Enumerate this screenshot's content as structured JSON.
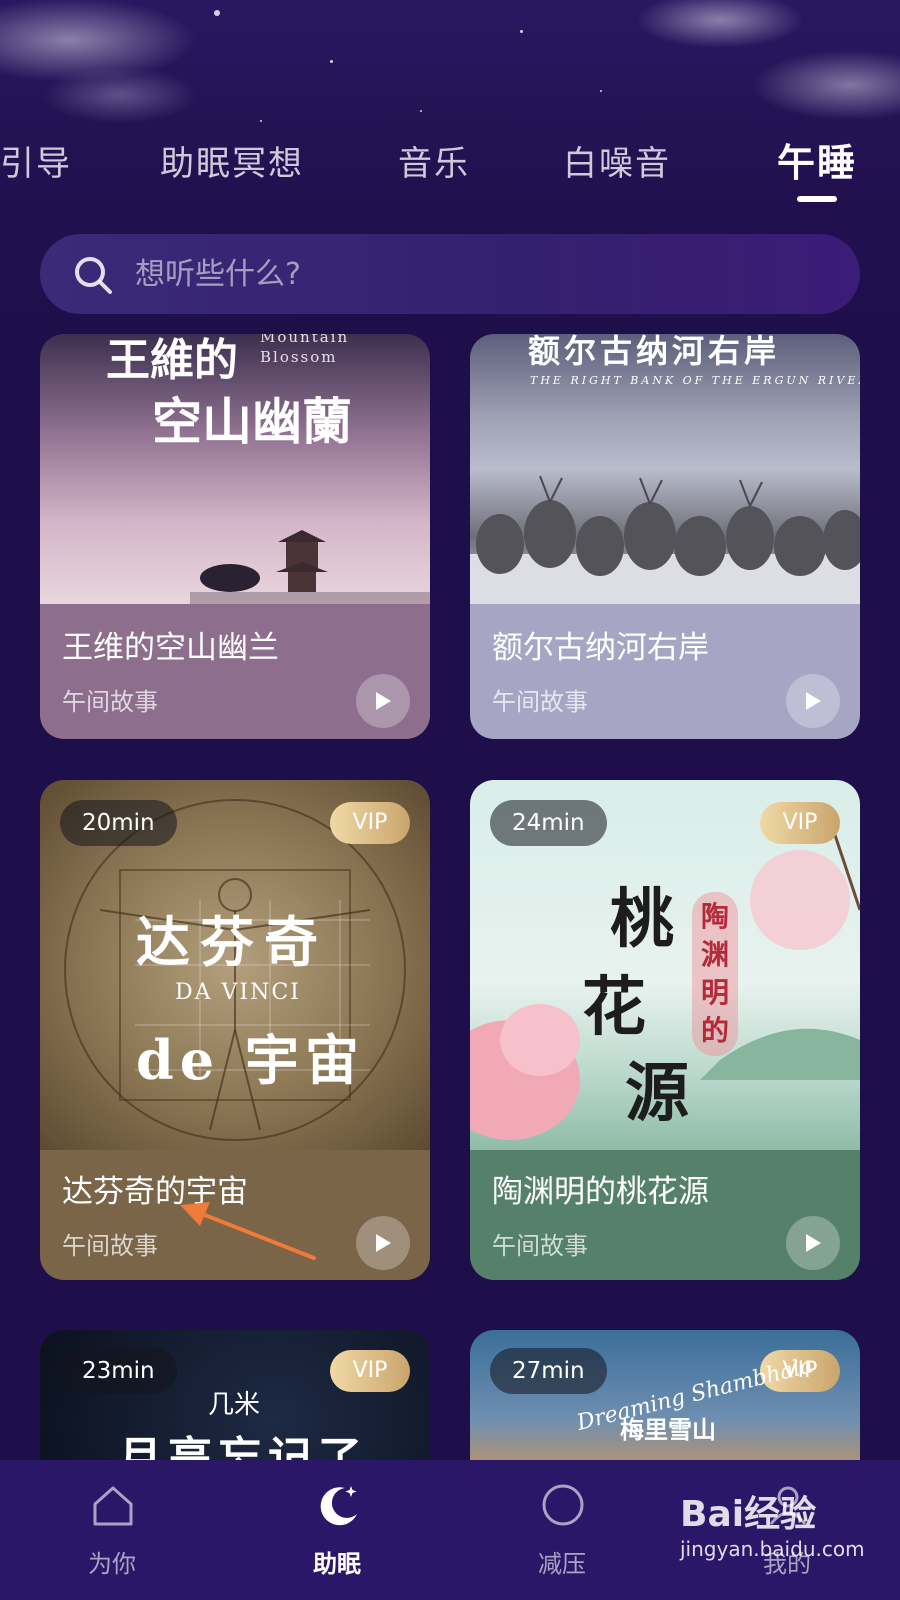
{
  "tabs": [
    {
      "label": "引导"
    },
    {
      "label": "助眠冥想"
    },
    {
      "label": "音乐"
    },
    {
      "label": "白噪音"
    },
    {
      "label": "午睡"
    }
  ],
  "search": {
    "placeholder": "想听些什么?"
  },
  "cards": [
    {
      "title": "王维的空山幽兰",
      "subtitle": "午间故事",
      "art_title_1": "王維的",
      "art_title_2": "空山幽蘭",
      "art_en_1": "Mountain",
      "art_en_2": "Blossom",
      "color": "#8d6e8c"
    },
    {
      "title": "额尔古纳河右岸",
      "subtitle": "午间故事",
      "art_title": "额尔古纳河右岸",
      "art_en": "THE RIGHT BANK OF THE ERGUN RIVER",
      "color": "#a6a6c4"
    },
    {
      "title": "达芬奇的宇宙",
      "subtitle": "午间故事",
      "duration": "20min",
      "badge": "VIP",
      "art_title_1": "达芬奇",
      "art_en": "DA VINCI",
      "art_title_2": "de 宇宙",
      "color": "#7a6548"
    },
    {
      "title": "陶渊明的桃花源",
      "subtitle": "午间故事",
      "duration": "24min",
      "badge": "VIP",
      "art_title_1": "桃",
      "art_title_2": "花",
      "art_title_3": "源",
      "art_author": "陶渊明的",
      "color": "#55806a"
    },
    {
      "duration": "23min",
      "badge": "VIP",
      "art_title_1": "几米",
      "art_title_2": "月亮忘记了"
    },
    {
      "duration": "27min",
      "badge": "VIP",
      "art_en": "Dreaming Shambhala",
      "art_title": "梅里雪山"
    }
  ],
  "nav": [
    {
      "label": "为你",
      "icon": "home-icon"
    },
    {
      "label": "助眠",
      "icon": "moon-icon",
      "active": true
    },
    {
      "label": "减压",
      "icon": "circle-icon"
    },
    {
      "label": "我的",
      "icon": "profile-icon"
    }
  ],
  "watermark": {
    "brand": "Bai经验",
    "url": "jingyan.baidu.com"
  },
  "colors": {
    "background": "#1e0f4a",
    "nav_background": "#2a1768",
    "vip_gold": "#d4b27a"
  }
}
